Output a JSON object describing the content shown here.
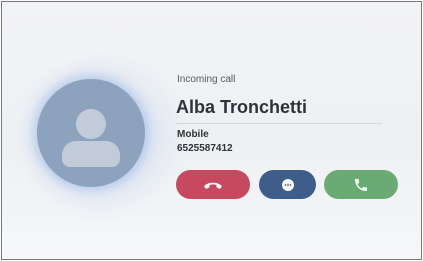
{
  "call": {
    "status": "Incoming call",
    "caller_name": "Alba Tronchetti",
    "phone_type": "Mobile",
    "phone_number": "6525587412"
  },
  "actions": [
    {
      "id": "decline",
      "icon": "hang-up-icon",
      "color": "#c64960"
    },
    {
      "id": "message",
      "icon": "message-icon",
      "color": "#3e5d8a"
    },
    {
      "id": "accept",
      "icon": "phone-icon",
      "color": "#6aab73"
    }
  ],
  "avatar": {
    "icon": "person-icon",
    "color": "#8da2bd"
  }
}
